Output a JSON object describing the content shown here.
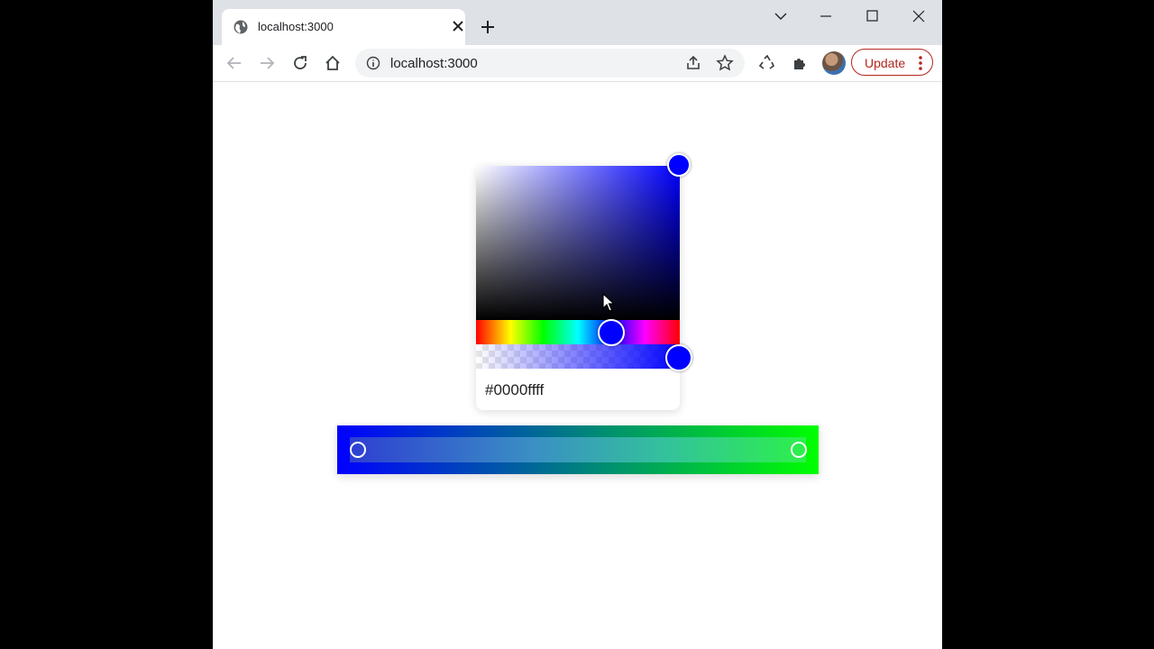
{
  "browser": {
    "tab_title": "localhost:3000",
    "url": "localhost:3000",
    "update_label": "Update"
  },
  "picker": {
    "hex_value": "#0000ffff",
    "color": "#0000ff",
    "hue": 240,
    "saturation": 1,
    "brightness": 1,
    "alpha": 1
  },
  "gradient": {
    "stops": [
      {
        "color": "#0000ff",
        "position": 0
      },
      {
        "color": "#00ff00",
        "position": 1
      }
    ]
  },
  "icons": [
    "globe-icon",
    "close-icon",
    "new-tab-icon",
    "back-icon",
    "forward-icon",
    "reload-icon",
    "home-icon",
    "info-icon",
    "share-icon",
    "star-icon",
    "recycle-icon",
    "extensions-icon",
    "more-icon"
  ]
}
